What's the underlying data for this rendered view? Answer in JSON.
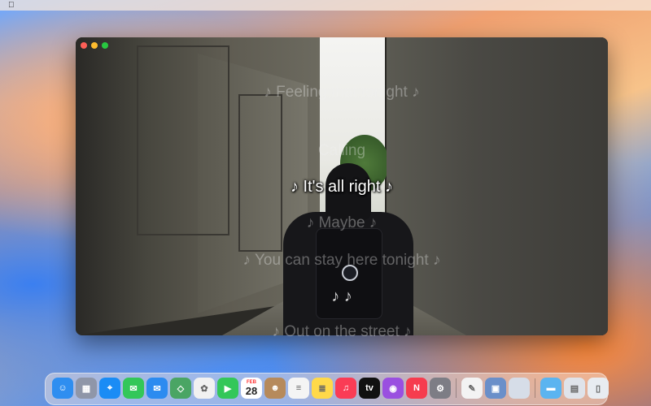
{
  "menubar": {
    "apple_icon": "apple-logo"
  },
  "window": {
    "traffic_lights": [
      "close",
      "minimize",
      "zoom"
    ]
  },
  "lyrics": {
    "line1": "♪ Feeling that tonight ♪",
    "line2": "Calling",
    "current": "♪ It's all right ♪",
    "line4": "♪ Maybe ♪",
    "line5": "♪ You can stay here tonight ♪",
    "line6": "♪ ♪",
    "line7": "♪ Out on the street ♪"
  },
  "dock": {
    "calendar_month": "FEB",
    "calendar_day": "28",
    "apps": [
      {
        "name": "finder",
        "glyph": "☺",
        "color": "#2f8ef0"
      },
      {
        "name": "launchpad",
        "glyph": "▦",
        "color": "#8f96a8"
      },
      {
        "name": "safari",
        "glyph": "⌖",
        "color": "#1a8cf5"
      },
      {
        "name": "messages",
        "glyph": "✉",
        "color": "#33c759"
      },
      {
        "name": "mail",
        "glyph": "✉",
        "color": "#2c8bf0"
      },
      {
        "name": "maps",
        "glyph": "◇",
        "color": "#4aa564"
      },
      {
        "name": "photos",
        "glyph": "✿",
        "color": "#f1f1f1"
      },
      {
        "name": "facetime",
        "glyph": "▶",
        "color": "#33c759"
      },
      {
        "name": "calendar",
        "glyph": "",
        "color": "#ffffff"
      },
      {
        "name": "contacts",
        "glyph": "☻",
        "color": "#b68a5c"
      },
      {
        "name": "reminders",
        "glyph": "≡",
        "color": "#f4f4f4"
      },
      {
        "name": "notes",
        "glyph": "≣",
        "color": "#ffd94a"
      },
      {
        "name": "music",
        "glyph": "♫",
        "color": "#fa3c55"
      },
      {
        "name": "tv",
        "glyph": "tv",
        "color": "#111111"
      },
      {
        "name": "podcasts",
        "glyph": "◉",
        "color": "#9a4fe0"
      },
      {
        "name": "news",
        "glyph": "N",
        "color": "#f63c4e"
      },
      {
        "name": "system-settings",
        "glyph": "⚙",
        "color": "#7d7d85"
      },
      {
        "name": "freeform",
        "glyph": "✎",
        "color": "#f3f3f3"
      },
      {
        "name": "preview",
        "glyph": "▣",
        "color": "#6a8fc9"
      },
      {
        "name": "blank-window",
        "glyph": "",
        "color": "#d6dde8"
      },
      {
        "name": "folder",
        "glyph": "▬",
        "color": "#5bb4f0"
      },
      {
        "name": "archive",
        "glyph": "▤",
        "color": "#dfe3ea"
      },
      {
        "name": "trash",
        "glyph": "▯",
        "color": "#e8ecf1"
      }
    ]
  }
}
